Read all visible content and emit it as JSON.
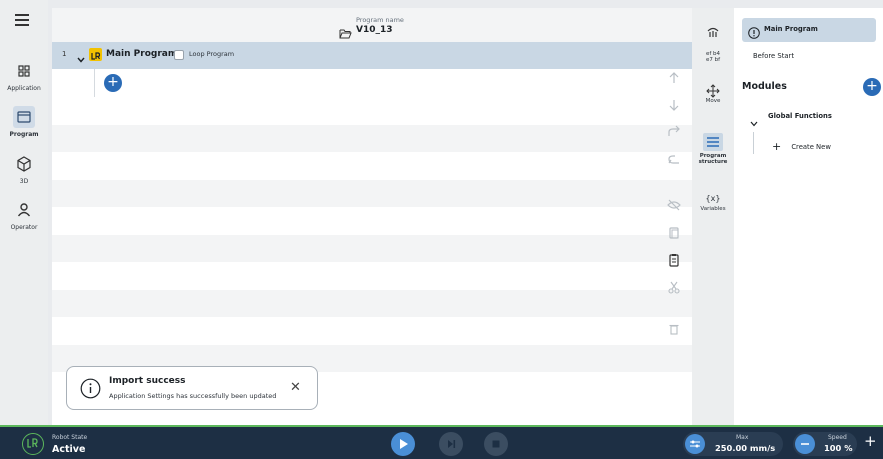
{
  "nav": {
    "items": [
      {
        "label": "Application"
      },
      {
        "label": "Program"
      },
      {
        "label": "3D"
      },
      {
        "label": "Operator"
      }
    ]
  },
  "header": {
    "program_name_label": "Program name",
    "program_name": "V10_13"
  },
  "program_tree": {
    "line_number": "1",
    "main_program_label": "Main Program",
    "loop_program_label": "Loop Program",
    "add_symbol": "+"
  },
  "toast": {
    "title": "Import success",
    "message": "Application Settings has successfully been updated",
    "close_symbol": "✕"
  },
  "right_tools": {
    "hex_label": "ef b4\ne7 bf",
    "move_label": "Move",
    "program_structure_label": "Program\nstructure",
    "variables_icon_text": "{x}",
    "variables_label": "Variables"
  },
  "structure_panel": {
    "main_program": "Main Program",
    "before_start": "Before Start",
    "modules_title": "Modules",
    "global_functions": "Global Functions",
    "create_new": "Create New"
  },
  "bottom_bar": {
    "robot_state_label": "Robot State",
    "robot_state_value": "Active",
    "max_label": "Max",
    "max_value": "250.00 mm/s",
    "speed_label": "Speed",
    "speed_value": "100 %",
    "plus_symbol": "+"
  },
  "colors": {
    "accent": "#2a6bb6",
    "selected_row": "#c9d7e4",
    "bottom_bar": "#1d2f44",
    "status_green": "#5cb85c",
    "logo_yellow": "#f2c200"
  }
}
